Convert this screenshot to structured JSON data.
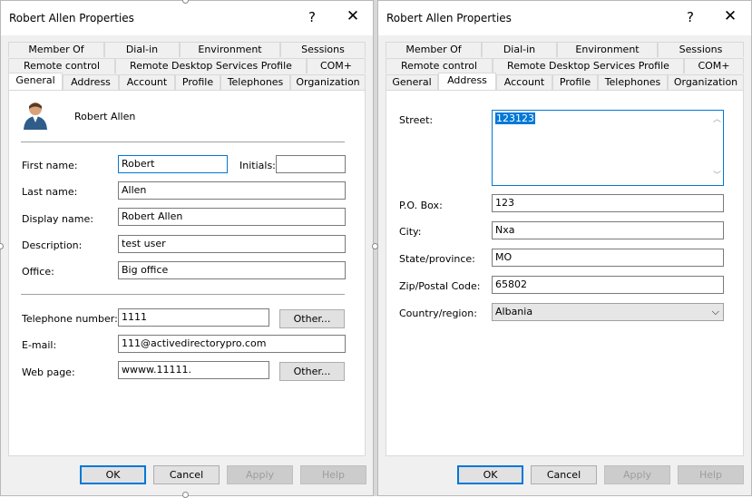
{
  "left": {
    "title": "Robert Allen Properties",
    "help": "?",
    "close": "✕",
    "tabs_row1": [
      "Member Of",
      "Dial-in",
      "Environment",
      "Sessions"
    ],
    "tabs_row2": [
      "Remote control",
      "Remote Desktop Services Profile",
      "COM+"
    ],
    "tabs_row3": [
      "General",
      "Address",
      "Account",
      "Profile",
      "Telephones",
      "Organization"
    ],
    "display_header": "Robert Allen",
    "labels": {
      "first_name": "First name:",
      "initials": "Initials:",
      "last_name": "Last name:",
      "display_name": "Display name:",
      "description": "Description:",
      "office": "Office:",
      "telephone": "Telephone number:",
      "email": "E-mail:",
      "web_page": "Web page:"
    },
    "values": {
      "first_name": "Robert",
      "initials": "",
      "last_name": "Allen",
      "display_name": "Robert Allen",
      "description": "test user",
      "office": "Big office",
      "telephone": "1111",
      "email": "111@activedirectorypro.com",
      "web_page": "wwww.11111."
    },
    "other_label": "Other...",
    "buttons": {
      "ok": "OK",
      "cancel": "Cancel",
      "apply": "Apply",
      "help": "Help"
    }
  },
  "right": {
    "title": "Robert Allen Properties",
    "help": "?",
    "close": "✕",
    "tabs_row1": [
      "Member Of",
      "Dial-in",
      "Environment",
      "Sessions"
    ],
    "tabs_row2": [
      "Remote control",
      "Remote Desktop Services Profile",
      "COM+"
    ],
    "tabs_row3": [
      "General",
      "Address",
      "Account",
      "Profile",
      "Telephones",
      "Organization"
    ],
    "labels": {
      "street": "Street:",
      "po_box": "P.O. Box:",
      "city": "City:",
      "state": "State/province:",
      "zip": "Zip/Postal Code:",
      "country": "Country/region:"
    },
    "values": {
      "street": "123123",
      "po_box": "123",
      "city": "Nxa",
      "state": "MO",
      "zip": "65802",
      "country": "Albania"
    },
    "buttons": {
      "ok": "OK",
      "cancel": "Cancel",
      "apply": "Apply",
      "help": "Help"
    }
  },
  "colors": {
    "accent": "#0078d7",
    "selection": "#0078d7"
  }
}
